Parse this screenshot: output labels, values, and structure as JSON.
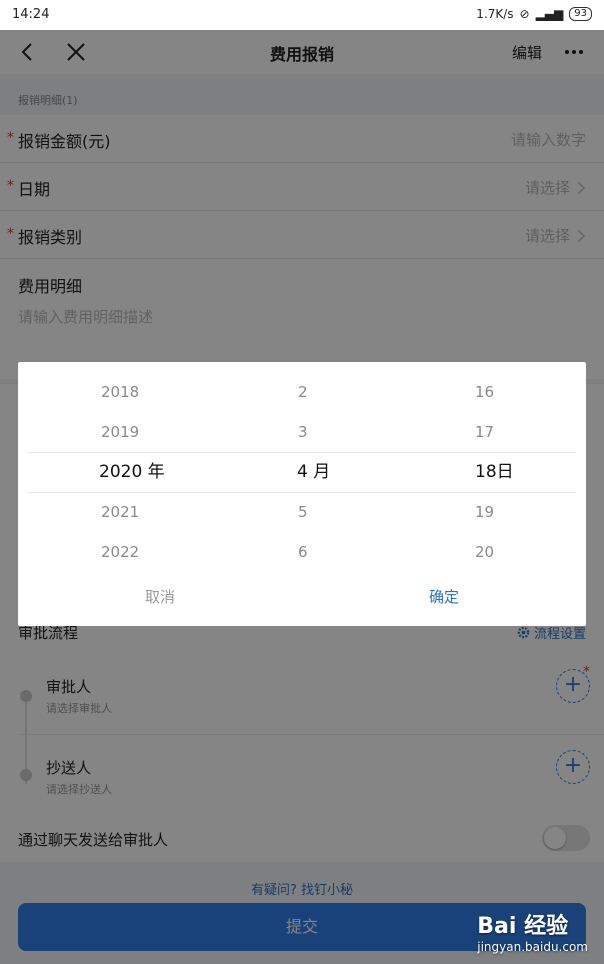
{
  "status_bar": {
    "time": "14:24",
    "net_speed": "1.7K/s",
    "battery": "93"
  },
  "nav": {
    "title": "费用报销",
    "edit_label": "编辑",
    "back_icon": "chevron-left-icon",
    "close_icon": "close-icon",
    "more_icon": "more-dots-icon"
  },
  "form": {
    "section_label": "报销明细(1)",
    "amount": {
      "label": "报销金额(元)",
      "placeholder": "请输入数字"
    },
    "date": {
      "label": "日期",
      "placeholder": "请选择"
    },
    "category": {
      "label": "报销类别",
      "placeholder": "请选择"
    },
    "detail": {
      "label": "费用明细",
      "placeholder": "请输入费用明细描述"
    }
  },
  "date_picker": {
    "years": [
      "2018",
      "2019",
      "2020 年",
      "2021",
      "2022"
    ],
    "months": [
      "2",
      "3",
      "4 月",
      "5",
      "6"
    ],
    "days": [
      "16",
      "17",
      "18日",
      "19",
      "20"
    ],
    "selected_index": 2,
    "cancel_label": "取消",
    "confirm_label": "确定"
  },
  "approval": {
    "title": "审批流程",
    "settings_label": "流程设置",
    "approver": {
      "name": "审批人",
      "hint": "请选择审批人"
    },
    "cc": {
      "name": "抄送人",
      "hint": "请选择抄送人"
    }
  },
  "notify": {
    "label": "通过聊天发送给审批人",
    "enabled": false
  },
  "help_link": "有疑问? 找钉小秘",
  "submit_label": "提交",
  "watermark": {
    "brand": "Bai 经验",
    "url": "jingyan.baidu.com"
  },
  "colors": {
    "accent": "#2b73c8",
    "required": "#e53935",
    "submit": "#2e7fe8"
  }
}
